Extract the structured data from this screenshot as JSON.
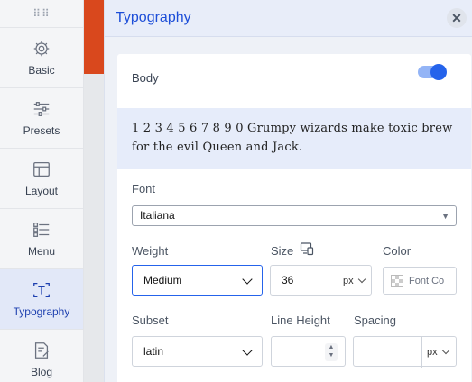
{
  "sidebar": {
    "items": [
      {
        "label": "Basic",
        "icon": "gear-icon",
        "active": false
      },
      {
        "label": "Presets",
        "icon": "sliders-icon",
        "active": false
      },
      {
        "label": "Layout",
        "icon": "layout-icon",
        "active": false
      },
      {
        "label": "Menu",
        "icon": "menu-icon",
        "active": false
      },
      {
        "label": "Typography",
        "icon": "typography-icon",
        "active": true
      },
      {
        "label": "Blog",
        "icon": "blog-icon",
        "active": false
      }
    ]
  },
  "panel": {
    "title": "Typography",
    "body_label": "Body",
    "body_enabled": true,
    "preview_text": "1 2 3 4 5 6 7 8 9 0 Grumpy wizards make toxic brew for the evil Queen and Jack.",
    "font": {
      "label": "Font",
      "value": "Italiana"
    },
    "weight": {
      "label": "Weight",
      "value": "Medium"
    },
    "size": {
      "label": "Size",
      "value": "36",
      "unit": "px"
    },
    "color": {
      "label": "Color",
      "placeholder": "Font Co"
    },
    "subset": {
      "label": "Subset",
      "value": "latin"
    },
    "line_height": {
      "label": "Line Height",
      "value": ""
    },
    "spacing": {
      "label": "Spacing",
      "value": "",
      "unit": "px"
    }
  },
  "colors": {
    "accent": "#2563eb",
    "preview_bg": "#e6ecfa",
    "orange": "#d9481d"
  }
}
